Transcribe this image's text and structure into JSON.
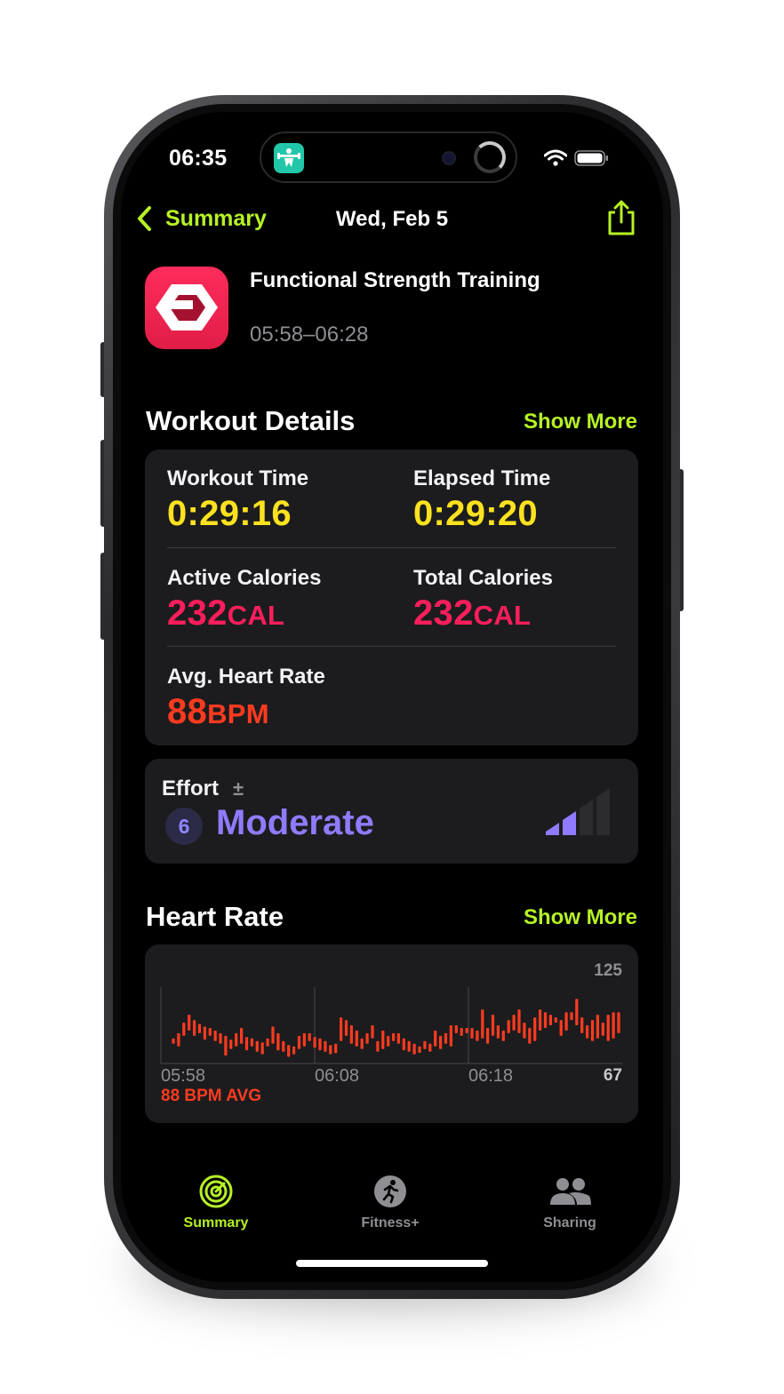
{
  "status_bar": {
    "time": "06:35"
  },
  "nav": {
    "back_label": "Summary",
    "title": "Wed, Feb 5"
  },
  "workout": {
    "name": "Functional Strength Training",
    "time_range": "05:58–06:28"
  },
  "details": {
    "title": "Workout Details",
    "show_more": "Show More",
    "workout_time": {
      "label": "Workout Time",
      "value": "0:29:16"
    },
    "elapsed_time": {
      "label": "Elapsed Time",
      "value": "0:29:20"
    },
    "active_calories": {
      "label": "Active Calories",
      "value": "232",
      "unit": "CAL"
    },
    "total_calories": {
      "label": "Total Calories",
      "value": "232",
      "unit": "CAL"
    },
    "avg_heart_rate": {
      "label": "Avg. Heart Rate",
      "value": "88",
      "unit": "BPM"
    }
  },
  "effort": {
    "label": "Effort",
    "badge": "6",
    "value": "Moderate",
    "icon": "plus-minus-icon",
    "level_filled": 2,
    "level_total": 4
  },
  "heart_rate": {
    "title": "Heart Rate",
    "show_more": "Show More",
    "max_label": "125",
    "min_label": "67",
    "avg_label": "88 BPM AVG",
    "time_labels": [
      "05:58",
      "06:08",
      "06:18"
    ]
  },
  "tabs": [
    {
      "label": "Summary",
      "icon": "activity-rings-icon",
      "active": true
    },
    {
      "label": "Fitness+",
      "icon": "fitness-runner-icon",
      "active": false
    },
    {
      "label": "Sharing",
      "icon": "people-icon",
      "active": false
    }
  ],
  "colors": {
    "accent": "#b6f224",
    "time": "#ffe21f",
    "calories": "#ff1e5c",
    "heart": "#ff3b1f",
    "effort": "#8f7bff"
  },
  "chart_data": {
    "type": "bar",
    "ylim": [
      67,
      125
    ],
    "x_labels": [
      "05:58",
      "06:08",
      "06:18"
    ],
    "series": [
      {
        "values": [
          [
            82,
            86
          ],
          [
            80,
            90
          ],
          [
            88,
            98
          ],
          [
            92,
            104
          ],
          [
            88,
            100
          ],
          [
            90,
            97
          ],
          [
            85,
            95
          ],
          [
            88,
            94
          ],
          [
            84,
            92
          ],
          [
            82,
            90
          ],
          [
            73,
            88
          ],
          [
            78,
            85
          ],
          [
            80,
            90
          ],
          [
            82,
            94
          ],
          [
            77,
            87
          ],
          [
            80,
            86
          ],
          [
            76,
            84
          ],
          [
            74,
            83
          ],
          [
            80,
            86
          ],
          [
            82,
            95
          ],
          [
            77,
            90
          ],
          [
            76,
            84
          ],
          [
            72,
            81
          ],
          [
            74,
            80
          ],
          [
            78,
            88
          ],
          [
            80,
            90
          ],
          [
            84,
            90
          ],
          [
            79,
            87
          ],
          [
            77,
            86
          ],
          [
            76,
            84
          ],
          [
            74,
            81
          ],
          [
            75,
            82
          ],
          [
            84,
            102
          ],
          [
            88,
            100
          ],
          [
            82,
            96
          ],
          [
            80,
            92
          ],
          [
            78,
            86
          ],
          [
            82,
            90
          ],
          [
            86,
            96
          ],
          [
            76,
            84
          ],
          [
            78,
            92
          ],
          [
            80,
            88
          ],
          [
            84,
            90
          ],
          [
            82,
            90
          ],
          [
            77,
            86
          ],
          [
            76,
            84
          ],
          [
            74,
            82
          ],
          [
            75,
            80
          ],
          [
            78,
            84
          ],
          [
            76,
            82
          ],
          [
            80,
            92
          ],
          [
            78,
            88
          ],
          [
            82,
            90
          ],
          [
            80,
            96
          ],
          [
            90,
            96
          ],
          [
            88,
            94
          ],
          [
            90,
            94
          ],
          [
            86,
            94
          ],
          [
            84,
            92
          ],
          [
            86,
            108
          ],
          [
            82,
            94
          ],
          [
            88,
            104
          ],
          [
            86,
            96
          ],
          [
            84,
            92
          ],
          [
            90,
            100
          ],
          [
            92,
            104
          ],
          [
            90,
            108
          ],
          [
            86,
            98
          ],
          [
            82,
            94
          ],
          [
            84,
            102
          ],
          [
            92,
            108
          ],
          [
            94,
            106
          ],
          [
            96,
            104
          ],
          [
            98,
            102
          ],
          [
            88,
            100
          ],
          [
            92,
            106
          ],
          [
            100,
            106
          ],
          [
            96,
            116
          ],
          [
            90,
            102
          ],
          [
            86,
            96
          ],
          [
            84,
            100
          ],
          [
            86,
            104
          ],
          [
            88,
            98
          ],
          [
            84,
            104
          ],
          [
            86,
            106
          ],
          [
            90,
            106
          ]
        ]
      }
    ]
  }
}
